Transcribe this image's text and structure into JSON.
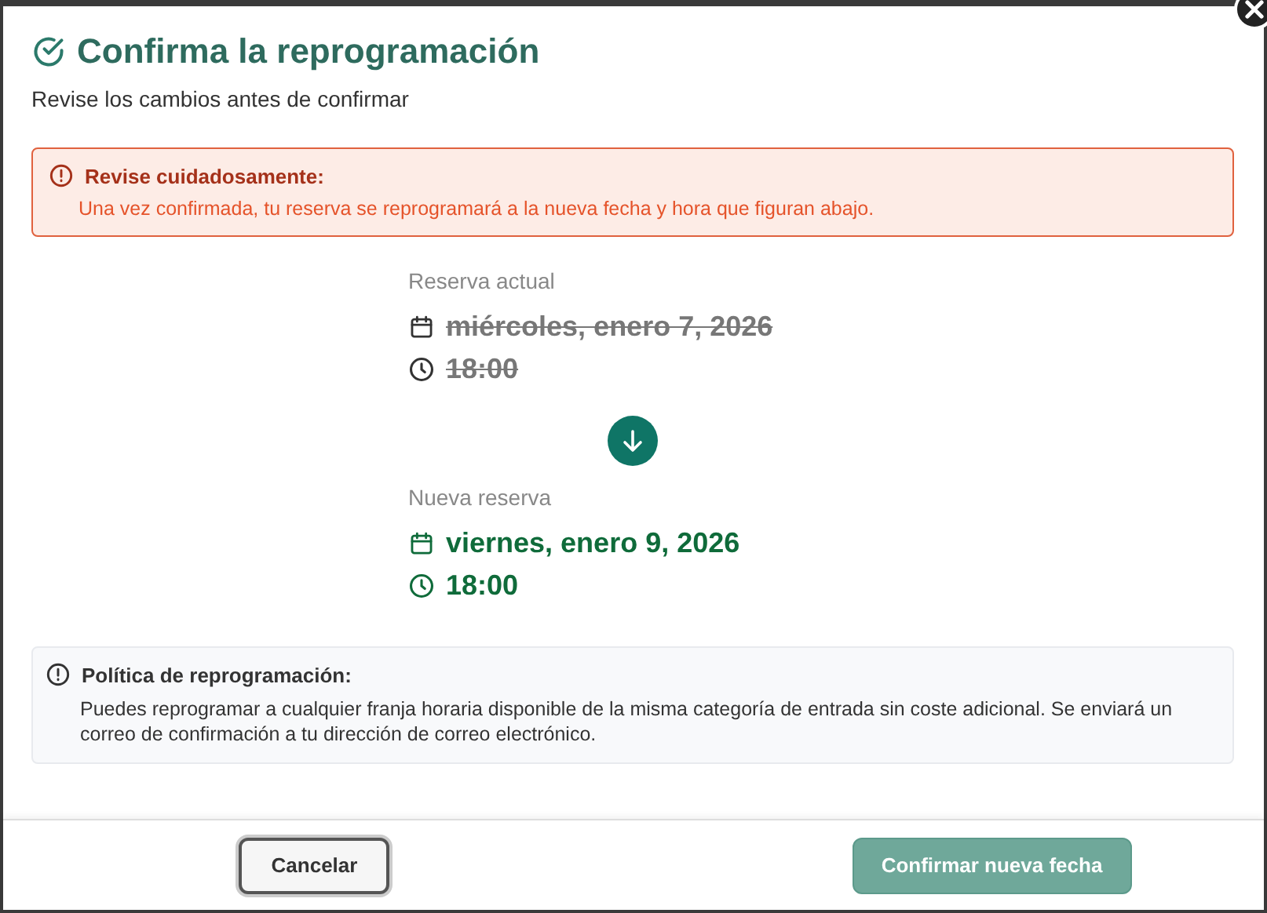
{
  "header": {
    "title": "Confirma la reprogramación",
    "subtitle": "Revise los cambios antes de confirmar"
  },
  "warning": {
    "title": "Revise cuidadosamente:",
    "text": "Una vez confirmada, tu reserva se reprogramará a la nueva fecha y hora que figuran abajo."
  },
  "bookings": [
    {
      "kind": "old",
      "label": "Reserva actual",
      "date": "miércoles, enero 7, 2026",
      "time": "18:00"
    },
    {
      "kind": "new",
      "label": "Nueva reserva",
      "date": "viernes, enero 9, 2026",
      "time": "18:00"
    }
  ],
  "policy": {
    "title": "Política de reprogramación:",
    "text": "Puedes reprogramar a cualquier franja horaria disponible de la misma categoría de entrada sin coste adicional. Se enviará un correo de confirmación a tu dirección de correo electrónico."
  },
  "buttons": [
    {
      "kind": "secondary",
      "label": "Cancelar",
      "disabled": false
    },
    {
      "kind": "primary",
      "label": "Confirmar nueva fecha",
      "disabled": true
    }
  ]
}
